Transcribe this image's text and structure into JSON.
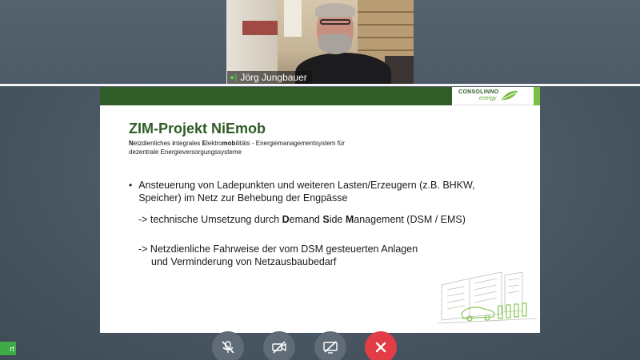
{
  "participant": {
    "name": "Jörg Jungbauer",
    "speaker_icon": "speaker-icon"
  },
  "slide": {
    "logo_line1": "CONSOLINNO",
    "logo_line2": "energy",
    "title": "ZIM-Projekt NiEmob",
    "subtitle_parts": {
      "p1_bold": "N",
      "p1": "etzdienliches ",
      "p2_bold": "i",
      "p2": "ntegrales ",
      "p3_bold": "E",
      "p3": "lektro",
      "p4_bold": "mob",
      "p4": "ilitäts - Energiemanagementsystem für",
      "line2": "dezentrale Energieversorgungssysteme"
    },
    "bullet": "Ansteuerung von Ladepunkten und weiteren Lasten/Erzeugern (z.B. BHKW, Speicher) im Netz zur Behebung der Engpässe",
    "arrow1_parts": {
      "a": "-> technische Umsetzung durch ",
      "b_bold": "D",
      "c": "emand ",
      "d_bold": "S",
      "e": "ide ",
      "f_bold": "M",
      "g": "anagement  (DSM / EMS)"
    },
    "arrow2_line1": "-> Netzdienliche Fahrweise der vom DSM gesteuerten Anlagen",
    "arrow2_line2": "und Verminderung von Netzausbaubedarf"
  },
  "controls": [
    {
      "name": "mic-muted-icon"
    },
    {
      "name": "camera-off-icon"
    },
    {
      "name": "screen-share-off-icon"
    },
    {
      "name": "hang-up-icon"
    }
  ],
  "side_tab": {
    "label": "rt"
  },
  "colors": {
    "slide_green": "#2f5c27",
    "hangup_red": "#e23c46",
    "control_gray": "#5f6b77"
  }
}
